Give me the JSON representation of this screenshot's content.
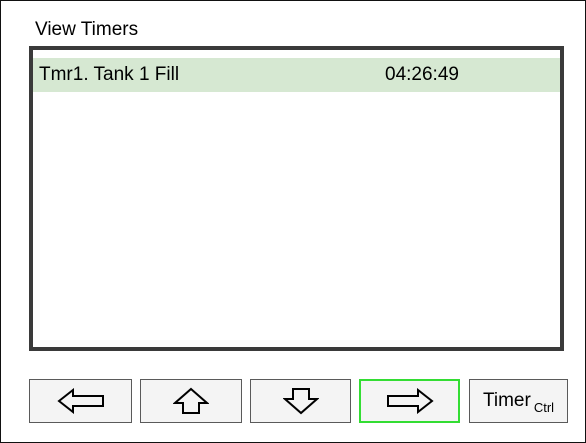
{
  "screen": {
    "title": "View Timers"
  },
  "timers": [
    {
      "name": "Tmr1. Tank 1 Fill",
      "time": "04:26:49",
      "selected": true
    }
  ],
  "toolbar": {
    "left_icon": "left-arrow-icon",
    "up_icon": "up-arrow-icon",
    "down_icon": "down-arrow-icon",
    "right_icon": "right-arrow-icon",
    "timer_label": "Timer",
    "timer_sub": "Ctrl"
  },
  "colors": {
    "selected_row": "#d6e8d2",
    "active_button_border": "#33dd33",
    "frame": "#3a3a3a"
  }
}
